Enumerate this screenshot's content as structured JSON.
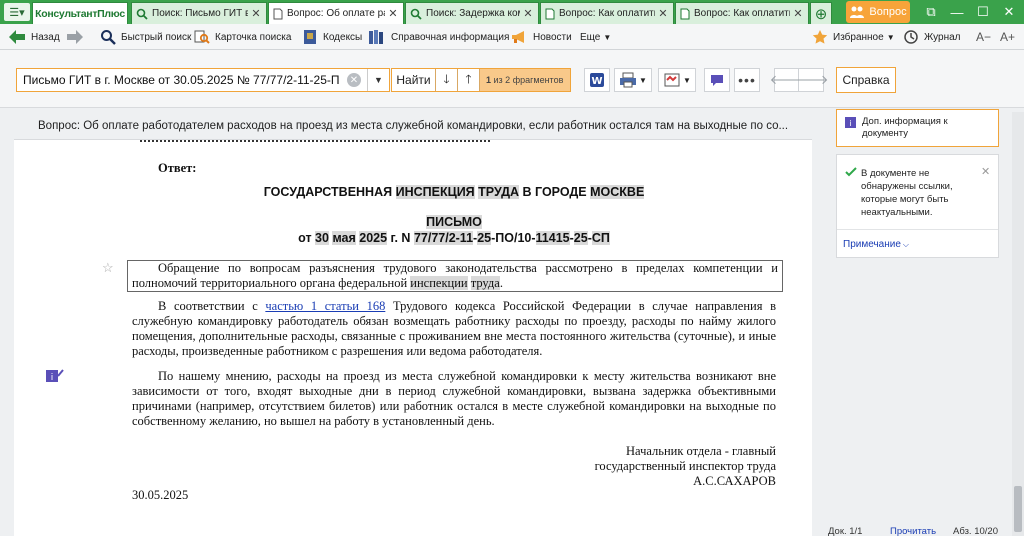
{
  "app": {
    "logo": "КонсультантПлюс",
    "question_button": "Вопрос"
  },
  "tabs": [
    {
      "label": "Поиск:  Письмо ГИТ в",
      "active": false,
      "icon": "search-icon"
    },
    {
      "label": "Вопрос: Об оплате ра",
      "active": true,
      "icon": "document-icon"
    },
    {
      "label": "Поиск: Задержка ком",
      "active": false,
      "icon": "search-icon"
    },
    {
      "label": "Вопрос: Как оплатить",
      "active": false,
      "icon": "document-icon"
    },
    {
      "label": "Вопрос: Как оплатить",
      "active": false,
      "icon": "document-icon"
    }
  ],
  "toolbar": {
    "back": "Назад",
    "quick_search": "Быстрый поиск",
    "search_card": "Карточка поиска",
    "codes": "Кодексы",
    "reference": "Справочная информация",
    "news": "Новости",
    "more": "Еще",
    "favorites": "Избранное",
    "journal": "Журнал",
    "font_smaller": "A−",
    "font_larger": "A+"
  },
  "search": {
    "value": "Письмо ГИТ в г. Москве от 30.05.2025 № 77/77/2-11-25-П",
    "find_label": "Найти",
    "fragments_count": "1",
    "fragments_text": "из 2 фрагментов"
  },
  "help_button": "Справка",
  "document": {
    "title_bar": "Вопрос: Об оплате работодателем расходов на проезд из места служебной командировки, если работник остался там на выходные по со...",
    "answer_label": "Ответ:",
    "org_line": [
      {
        "t": "ГОСУДАРСТВЕННАЯ ",
        "h": false
      },
      {
        "t": "ИНСПЕКЦИЯ",
        "h": true
      },
      {
        "t": " ",
        "h": false
      },
      {
        "t": "ТРУДА",
        "h": true
      },
      {
        "t": " В ГОРОДЕ ",
        "h": false
      },
      {
        "t": "МОСКВЕ",
        "h": true
      }
    ],
    "letter_label": "ПИСЬМО",
    "date_line": [
      {
        "t": "от ",
        "h": false
      },
      {
        "t": "30",
        "h": true
      },
      {
        "t": " ",
        "h": false
      },
      {
        "t": "мая",
        "h": true
      },
      {
        "t": " ",
        "h": false
      },
      {
        "t": "2025",
        "h": true
      },
      {
        "t": " г. N ",
        "h": false
      },
      {
        "t": "77/77/2-11",
        "h": true
      },
      {
        "t": "-",
        "h": false
      },
      {
        "t": "25",
        "h": true
      },
      {
        "t": "-ПО/10-",
        "h": false
      },
      {
        "t": "11415",
        "h": true
      },
      {
        "t": "-",
        "h": false
      },
      {
        "t": "25",
        "h": true
      },
      {
        "t": "-",
        "h": false
      },
      {
        "t": "СП",
        "h": true
      }
    ],
    "para1": [
      {
        "t": "Обращение по вопросам разъяснения трудового законодательства рассмотрено в пределах компетенции и полномочий территориального органа федеральной ",
        "h": false
      },
      {
        "t": "инспекции",
        "h": true
      },
      {
        "t": " ",
        "h": false
      },
      {
        "t": "труда",
        "h": true
      },
      {
        "t": ".",
        "h": false
      }
    ],
    "para2_before": "В соответствии с ",
    "para2_link": "частью 1 статьи 168",
    "para2_after": " Трудового кодекса Российской Федерации в случае направления в служебную командировку работодатель обязан возмещать работнику расходы по проезду, расходы по найму жилого помещения, дополнительные расходы, связанные с проживанием вне места постоянного жительства (суточные), и иные расходы, произведенные работником с разрешения или ведома работодателя.",
    "para3": "По нашему мнению, расходы на проезд из места служебной командировки к месту жительства возникают вне зависимости от того, входят выходные дни в период служебной командировки, вызвана задержка объективными причинами (например, отсутствием билетов) или работник остался в месте служебной командировки на выходные по собственному желанию, но вышел на работу в установленный день.",
    "signature": [
      "Начальник отдела - главный",
      "государственный инспектор труда",
      "А.С.САХАРОВ"
    ],
    "sign_date": "30.05.2025"
  },
  "right_panel": {
    "info_text": "Доп. информация к документу",
    "note_text": "В документе не обнаружены ссылки, которые могут быть неактуальными.",
    "note_link": "Примечание"
  },
  "status": {
    "doc": "Док. 1/1",
    "read": "Прочитать",
    "abz": "Абз. 10/20"
  }
}
